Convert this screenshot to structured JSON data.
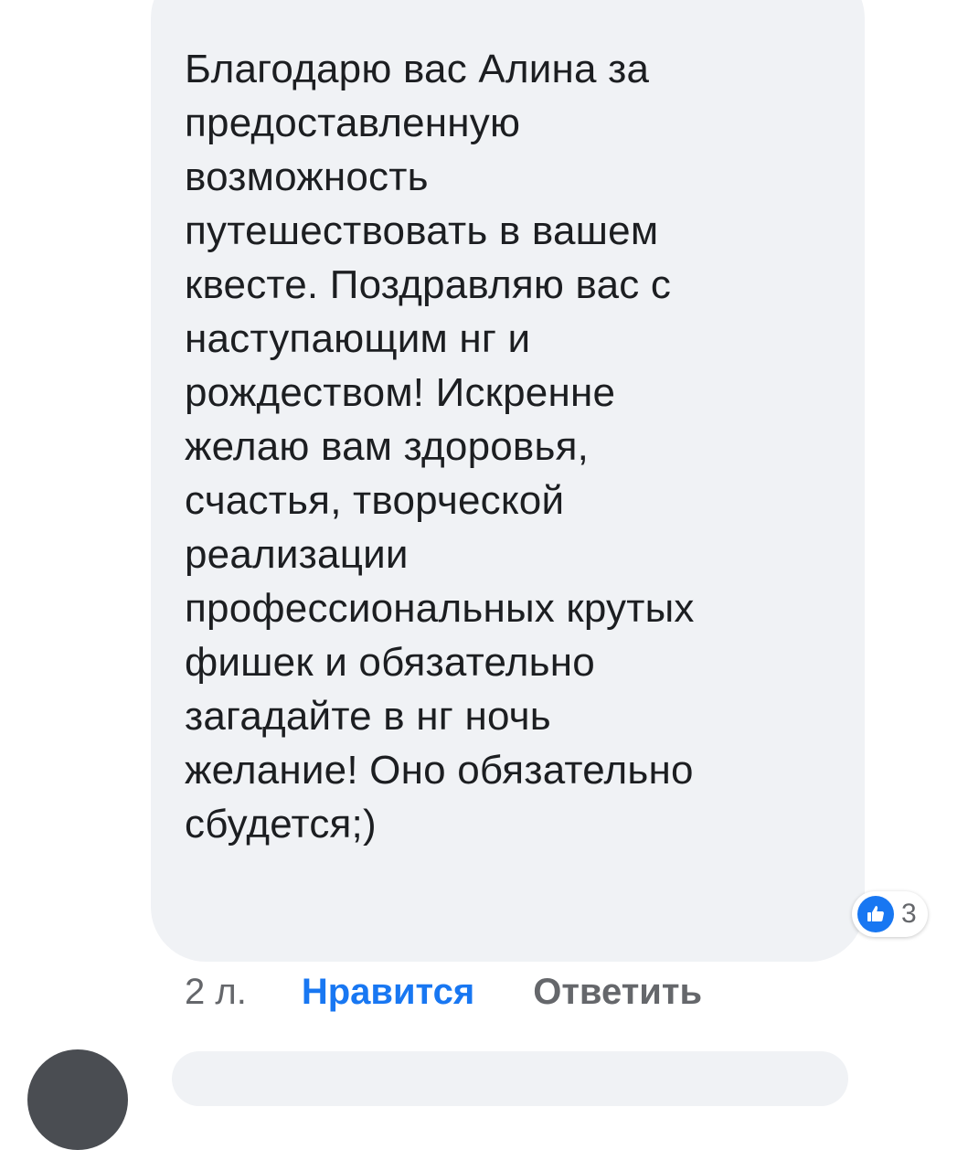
{
  "comment": {
    "lines": [
      "Благодарю вас Алина за",
      "предоставленную",
      "возможность",
      "путешествовать в вашем",
      "квесте. Поздравляю вас с",
      "наступающим нг и",
      "рождеством! Искренне",
      "желаю вам здоровья,",
      "счастья, творческой",
      "реализации",
      "профессиональных крутых",
      "фишек и обязательно",
      "загадайте в нг ночь",
      "желание! Оно обязательно",
      "сбудется;)"
    ]
  },
  "reactions": {
    "icon": "thumbs-up-icon",
    "count": "3",
    "color": "#1877f2"
  },
  "actions": {
    "timestamp": "2 л.",
    "like_label": "Нравится",
    "reply_label": "Ответить"
  },
  "colors": {
    "bubble_bg": "#f0f2f5",
    "text": "#1c1e21",
    "muted": "#65676b",
    "accent": "#1877f2"
  }
}
